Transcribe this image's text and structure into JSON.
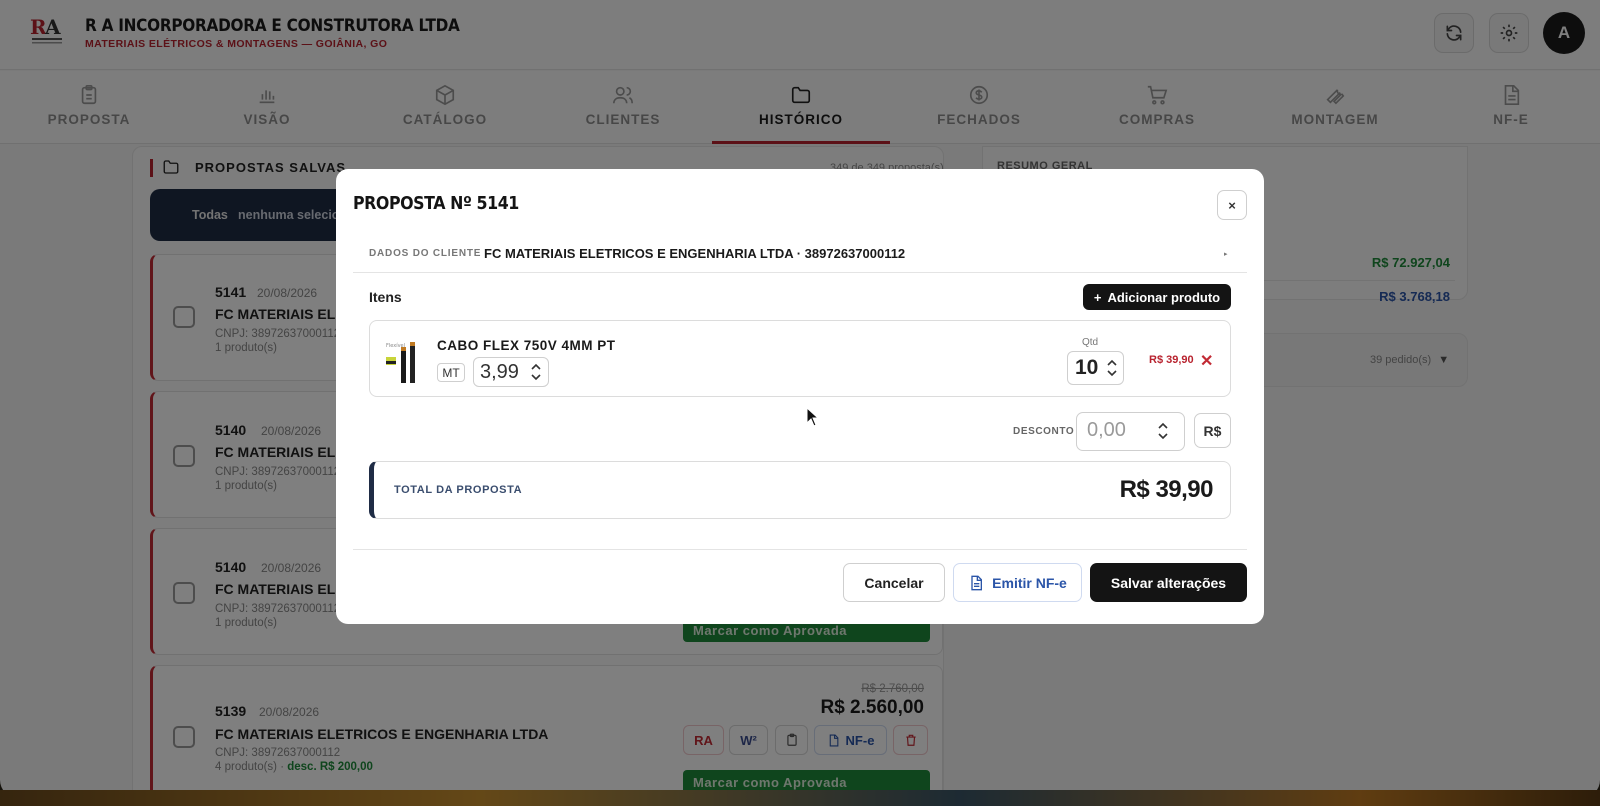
{
  "header": {
    "company_name": "R A INCORPORADORA E CONSTRUTORA LTDA",
    "company_sub": "MATERIAIS ELÉTRICOS & MONTAGENS — GOIÂNIA, GO",
    "avatar_initial": "A"
  },
  "nav": {
    "tabs": [
      {
        "label": "PROPOSTA",
        "icon": "clipboard-icon"
      },
      {
        "label": "VISÃO",
        "icon": "bar-chart-icon"
      },
      {
        "label": "CATÁLOGO",
        "icon": "box-icon"
      },
      {
        "label": "CLIENTES",
        "icon": "users-icon"
      },
      {
        "label": "HISTÓRICO",
        "icon": "folder-icon",
        "active": true
      },
      {
        "label": "FECHADOS",
        "icon": "dollar-circle-icon"
      },
      {
        "label": "COMPRAS",
        "icon": "cart-icon"
      },
      {
        "label": "MONTAGEM",
        "icon": "wrench-icon"
      },
      {
        "label": "NF-E",
        "icon": "document-icon"
      }
    ]
  },
  "background": {
    "list_title": "PROPOSTAS SALVAS",
    "list_count": "349 de 349 proposta(s)",
    "filter_all": "Todas",
    "filter_none": "nenhuma selecio",
    "cards": [
      {
        "number": "5141",
        "date": "20/08/2026",
        "client": "FC MATERIAIS ELETR",
        "cnpj": "CNPJ: 38972637000112",
        "products": "1 produto(s)"
      },
      {
        "number": "5140",
        "date": "20/08/2026",
        "client": "FC MATERIAIS ELETR",
        "cnpj": "CNPJ: 38972637000112",
        "products": "1 produto(s)"
      },
      {
        "number": "5140",
        "date": "20/08/2026",
        "client": "FC MATERIAIS ELETR",
        "cnpj": "CNPJ: 38972637000112",
        "products": "1 produto(s)",
        "approve": "Marcar como Aprovada"
      },
      {
        "number": "5139",
        "date": "20/08/2026",
        "client": "FC MATERIAIS ELETRICOS E ENGENHARIA LTDA",
        "cnpj": "CNPJ: 38972637000112",
        "products": "4 produto(s) ·",
        "discount": "desc. R$ 200,00",
        "old_price": "R$ 2.760,00",
        "new_price": "R$ 2.560,00",
        "btn_ra": "RA",
        "btn_w": "W²",
        "btn_nfe": "NF-e",
        "approve": "Marcar como Aprovada"
      }
    ],
    "summary": {
      "title": "RESUMO GERAL",
      "value1": "R$ 72.927,04",
      "value2": "R$ 3.768,18",
      "orders": "39 pedido(s)"
    }
  },
  "modal": {
    "title": "PROPOSTA Nº 5141",
    "close_label": "×",
    "client_label": "DADOS DO CLIENTE",
    "client_value": "FC MATERIAIS ELETRICOS E ENGENHARIA LTDA · 38972637000112",
    "items_label": "Itens",
    "add_product_label": "Adicionar produto",
    "item": {
      "name": "CABO FLEX 750V 4MM PT",
      "unit": "MT",
      "unit_price": "3,99",
      "qty_label": "Qtd",
      "qty": "10",
      "total": "R$ 39,90"
    },
    "discount_label": "DESCONTO",
    "discount_placeholder": "0,00",
    "discount_currency": "R$",
    "total_label": "TOTAL DA PROPOSTA",
    "total_value": "R$ 39,90",
    "cancel_label": "Cancelar",
    "nfe_label": "Emitir NF-e",
    "save_label": "Salvar alterações"
  },
  "colors": {
    "brand_red": "#b8232f",
    "navy": "#1f2c45",
    "green": "#1f8b3a",
    "link_blue": "#2b55a8"
  }
}
